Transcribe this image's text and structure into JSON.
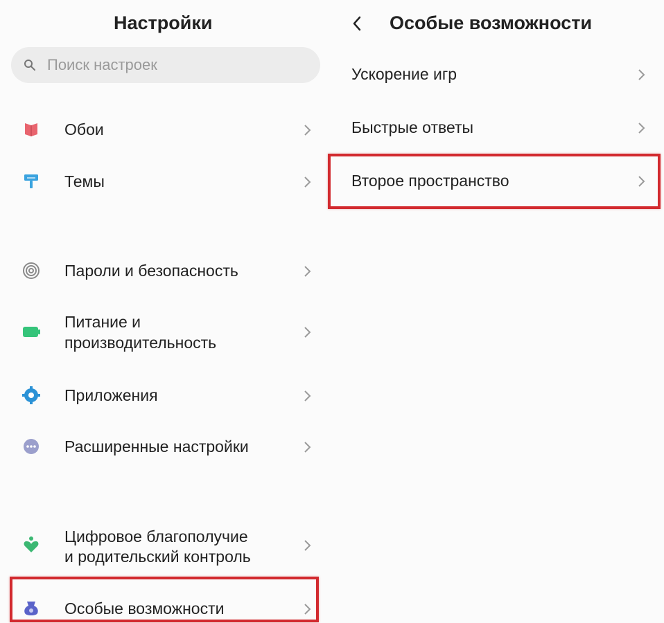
{
  "left": {
    "title": "Настройки",
    "search_placeholder": "Поиск настроек",
    "items": [
      {
        "line1": "Обои",
        "line2": "",
        "icon": "wallpaper-icon",
        "color": "#e8646e"
      },
      {
        "line1": "Темы",
        "line2": "",
        "icon": "themes-icon",
        "color": "#3aa3df"
      },
      {
        "line1": "Пароли и безопасность",
        "line2": "",
        "icon": "fingerprint-icon",
        "color": "#8a8a8a"
      },
      {
        "line1": "Питание и",
        "line2": "производительность",
        "icon": "battery-icon",
        "color": "#35c47a"
      },
      {
        "line1": "Приложения",
        "line2": "",
        "icon": "gear-icon",
        "color": "#2b92d6"
      },
      {
        "line1": "Расширенные настройки",
        "line2": "",
        "icon": "more-icon",
        "color": "#9b9fcc"
      },
      {
        "line1": "Цифровое благополучие",
        "line2": "и родительский контроль",
        "icon": "heart-icon",
        "color": "#3cb873"
      },
      {
        "line1": "Особые возможности",
        "line2": "",
        "icon": "accessibility-icon",
        "color": "#5a63c9"
      }
    ]
  },
  "right": {
    "title": "Особые возможности",
    "items": [
      {
        "label": "Ускорение игр"
      },
      {
        "label": "Быстрые ответы"
      },
      {
        "label": "Второе пространство"
      }
    ]
  },
  "colors": {
    "highlight": "#d22a2f",
    "search_bg": "#ececec",
    "chevron": "#9a9a9a"
  }
}
